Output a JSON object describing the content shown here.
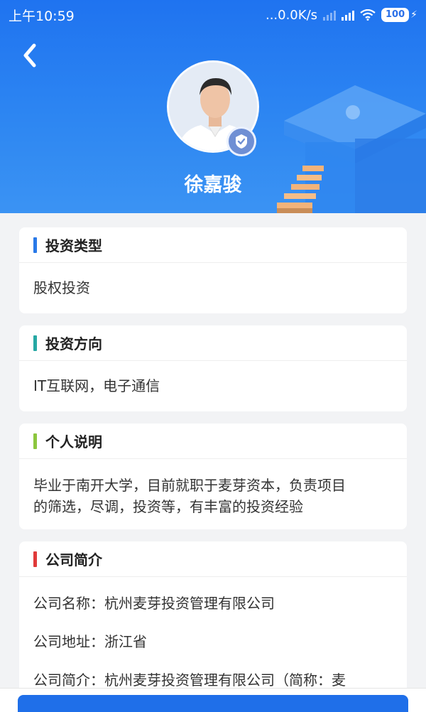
{
  "status_bar": {
    "time": "上午10:59",
    "speed": "...0.0K/s",
    "battery": "100"
  },
  "profile": {
    "name": "徐嘉骏"
  },
  "sections": {
    "investment_type": {
      "title": "投资类型",
      "content": "股权投资",
      "accent": "#2979e8"
    },
    "investment_direction": {
      "title": "投资方向",
      "content": "IT互联网，电子通信",
      "accent": "#26a8a4"
    },
    "personal_note": {
      "title": "个人说明",
      "line1": "毕业于南开大学，目前就职于麦芽资本，负责项目",
      "line2": "的筛选，尽调，投资等，有丰富的投资经验",
      "accent": "#8cc63e"
    },
    "company": {
      "title": "公司简介",
      "name_line": "公司名称：杭州麦芽投资管理有限公司",
      "address_line": "公司地址：浙江省",
      "intro_line": "公司简介：杭州麦芽投资管理有限公司（简称：麦",
      "accent": "#e03a3a"
    }
  },
  "icons": {
    "back": "chevron-left-icon",
    "verified": "verified-check-icon",
    "wifi": "wifi-icon"
  }
}
